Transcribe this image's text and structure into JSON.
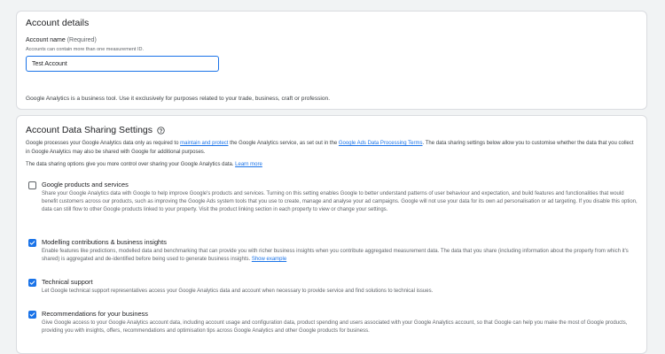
{
  "account_details": {
    "title": "Account details",
    "field_label": "Account name",
    "field_required": "(Required)",
    "field_hint": "Accounts can contain more than one measurement ID.",
    "field_value": "Test Account",
    "business_note": "Google Analytics is a business tool. Use it exclusively for purposes related to your trade, business, craft or profession."
  },
  "sharing": {
    "title": "Account Data Sharing Settings",
    "help_icon": "help-circle-icon",
    "intro_part1": "Google processes your Google Analytics data only as required to ",
    "intro_link1": "maintain and protect",
    "intro_part2": " the Google Analytics service, as set out in the ",
    "intro_link2": "Google Ads Data Processing Terms",
    "intro_part3": ". The data sharing settings below allow you to customise whether the data that you collect in Google Analytics may also be shared with Google for additional purposes.",
    "intro2_text": "The data sharing options give you more control over sharing your Google Analytics data. ",
    "intro2_link": "Learn more",
    "options": [
      {
        "title": "Google products and services",
        "checked": false,
        "desc": "Share your Google Analytics data with Google to help improve Google's products and services. Turning on this setting enables Google to better understand patterns of user behaviour and expectation, and build features and functionalities that would benefit customers across our products, such as improving the Google Ads system tools that you use to create, manage and analyse your ad campaigns. Google will not use your data for its own ad personalisation or ad targeting. If you disable this option, data can still flow to other Google products linked to your property. Visit the product linking section in each property to view or change your settings."
      },
      {
        "title": "Modelling contributions & business insights",
        "checked": true,
        "desc": "Enable features like predictions, modelled data and benchmarking that can provide you with richer business insights when you contribute aggregated measurement data. The data that you share (including information about the property from which it's shared) is aggregated and de-identified before being used to generate business insights. ",
        "link": "Show example"
      },
      {
        "title": "Technical support",
        "checked": true,
        "desc": "Let Google technical support representatives access your Google Analytics data and account when necessary to provide service and find solutions to technical issues."
      },
      {
        "title": "Recommendations for your business",
        "checked": true,
        "desc": "Give Google access to your Google Analytics account data, including account usage and configuration data, product spending and users associated with your Google Analytics account, so that Google can help you make the most of Google products, providing you with insights, offers, recommendations and optimisation tips across Google Analytics and other Google products for business."
      }
    ]
  },
  "colors": {
    "accent": "#1a73e8",
    "background": "#f1f3f4",
    "card": "#ffffff"
  }
}
